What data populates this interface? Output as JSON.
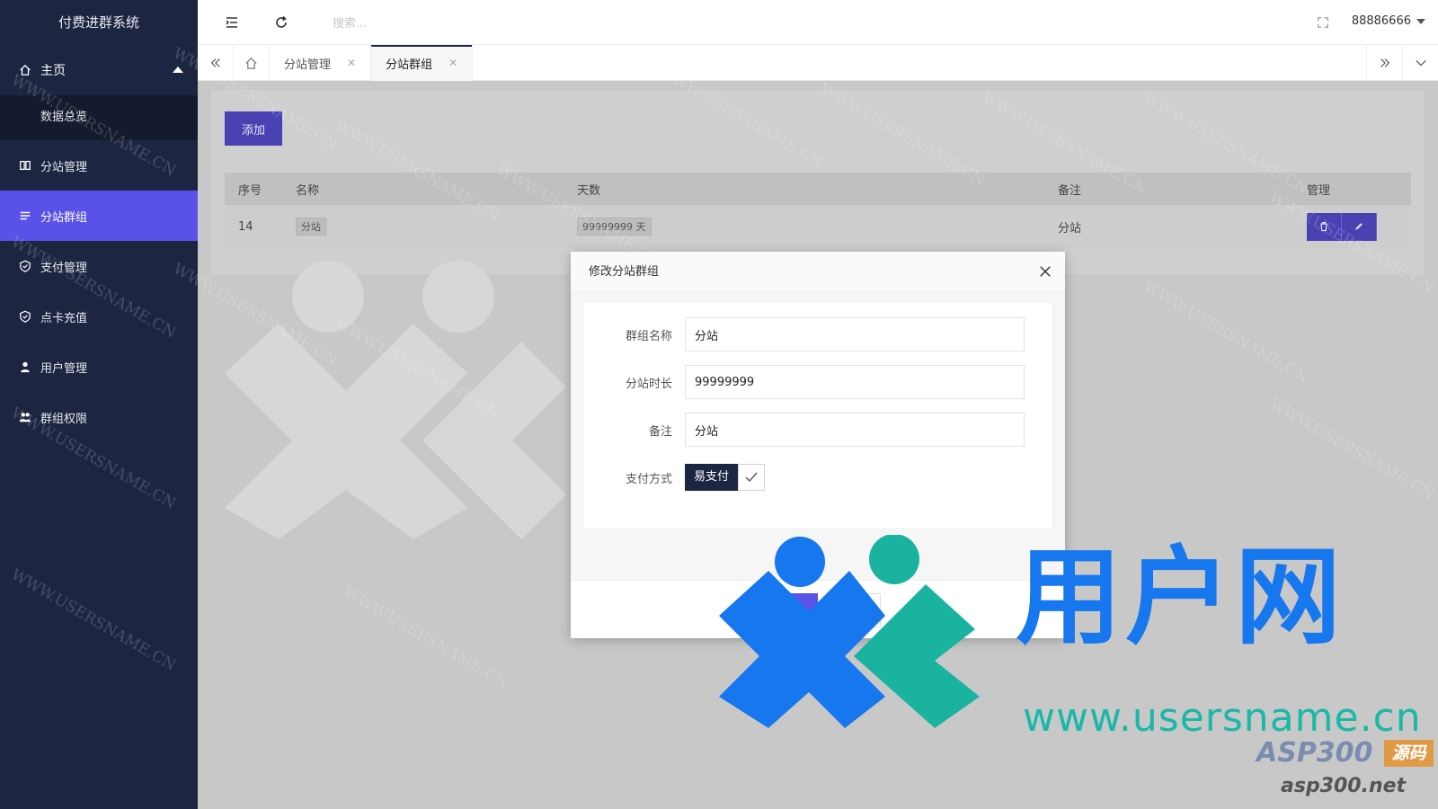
{
  "app": {
    "title": "付费进群系统"
  },
  "sidebar": {
    "home": {
      "label": "主页",
      "icon": "home-icon"
    },
    "sub_items": [
      {
        "label": "数据总览"
      }
    ],
    "items": [
      {
        "label": "分站管理",
        "icon": "columns-icon"
      },
      {
        "label": "分站群组",
        "icon": "list-icon",
        "active": true
      },
      {
        "label": "支付管理",
        "icon": "shield-check-icon"
      },
      {
        "label": "点卡充值",
        "icon": "shield-check-icon"
      },
      {
        "label": "用户管理",
        "icon": "user-icon"
      },
      {
        "label": "群组权限",
        "icon": "users-icon"
      }
    ]
  },
  "header": {
    "search_placeholder": "搜索...",
    "username": "88886666"
  },
  "tabs": [
    {
      "label": "分站管理",
      "active": false
    },
    {
      "label": "分站群组",
      "active": true
    }
  ],
  "toolbar": {
    "add_label": "添加"
  },
  "table": {
    "columns": [
      "序号",
      "名称",
      "天数",
      "备注",
      "管理"
    ],
    "rows": [
      {
        "id": "14",
        "name": "分站",
        "days": "99999999 天",
        "remark": "分站"
      }
    ]
  },
  "modal": {
    "title": "修改分站群组",
    "fields": {
      "group_name": {
        "label": "群组名称",
        "value": "分站"
      },
      "duration": {
        "label": "分站时长",
        "value": "99999999"
      },
      "remark": {
        "label": "备注",
        "value": "分站"
      },
      "payment": {
        "label": "支付方式",
        "value": "易支付"
      }
    },
    "submit_label": "提交",
    "reset_label": ""
  },
  "watermark": {
    "text": "WWW.USERSNAME.CN",
    "brand_cn": "用户网",
    "brand_url": "www.usersname.cn",
    "asp_logo": "ASP300",
    "asp_badge": "源码",
    "asp_url": "asp300.net"
  },
  "colors": {
    "sidebar_bg": "#1c2641",
    "accent": "#5a52e8",
    "primary_button": "#4a42b3"
  }
}
